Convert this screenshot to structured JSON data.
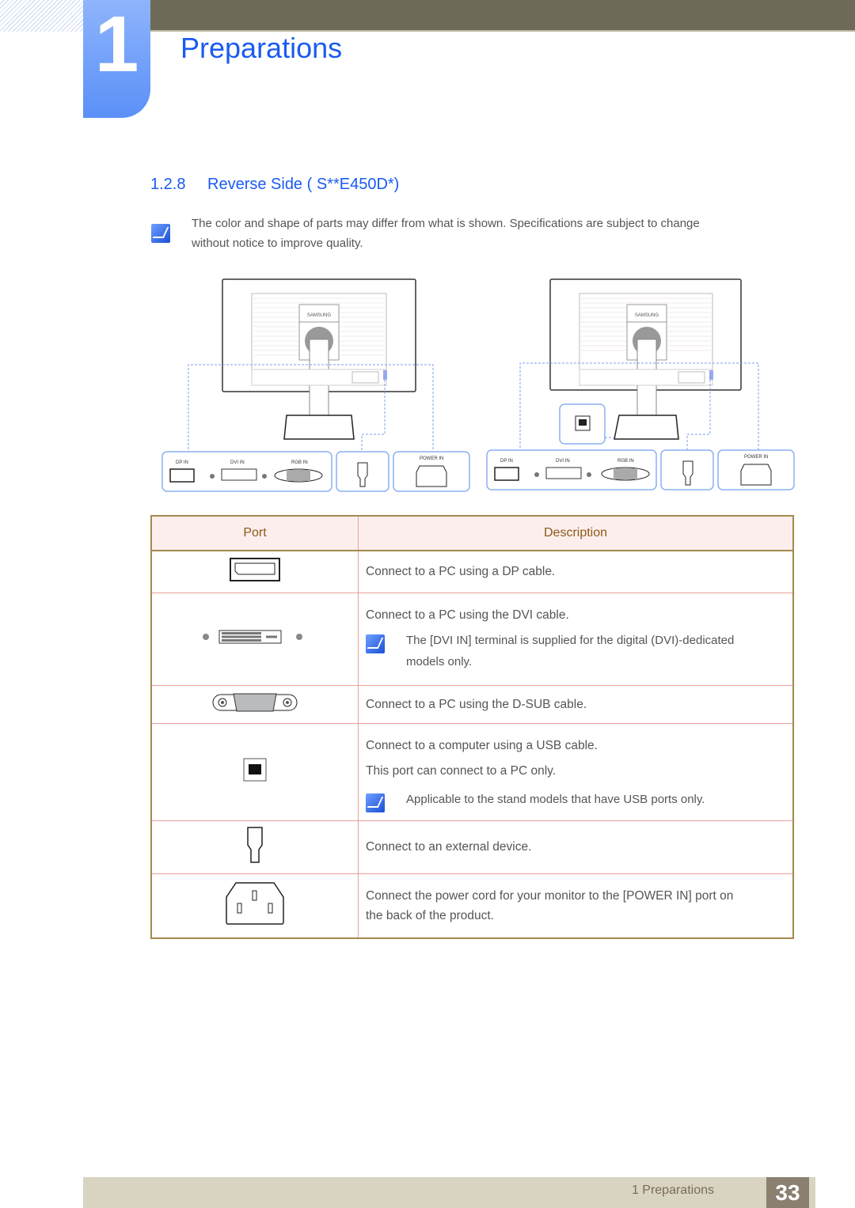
{
  "header": {
    "chapter_number": "1",
    "chapter_title": "Preparations"
  },
  "section": {
    "number": "1.2.8",
    "title": "Reverse Side ( S**E450D*)"
  },
  "intro_note": {
    "icon": "note-pencil-icon",
    "lines": [
      "The color and shape of parts may differ from what is shown. Specifications are subject to change",
      "without notice to improve quality."
    ]
  },
  "diagrams": {
    "left": {
      "brand": "SAMSUNG",
      "labels": {
        "dp": "DP IN",
        "dvi": "DVI IN",
        "rgb": "RGB IN",
        "power": "POWER IN"
      }
    },
    "right": {
      "brand": "SAMSUNG",
      "labels": {
        "dp": "DP IN",
        "dvi": "DVI IN",
        "rgb": "RGB IN",
        "power": "POWER IN"
      }
    }
  },
  "table": {
    "headers": {
      "port": "Port",
      "description": "Description"
    },
    "rows": [
      {
        "port_icon": "displayport-icon",
        "lines": [
          "Connect to a PC using a DP cable."
        ]
      },
      {
        "port_icon": "dvi-port-icon",
        "lines": [
          "Connect to a PC using the DVI cable."
        ],
        "note": [
          "The [DVI IN] terminal is supplied for the digital (DVI)-dedicated",
          "models only."
        ]
      },
      {
        "port_icon": "dsub-port-icon",
        "lines": [
          "Connect to a PC using the D-SUB cable."
        ]
      },
      {
        "port_icon": "usb-port-icon",
        "lines": [
          "Connect to a computer using a USB cable.",
          "This port can connect to a PC only."
        ],
        "note": [
          "Applicable to the stand models that have USB ports only."
        ]
      },
      {
        "port_icon": "external-device-port-icon",
        "lines": [
          "Connect to an external device."
        ]
      },
      {
        "port_icon": "power-in-port-icon",
        "lines": [
          "Connect the power cord for your monitor to the [POWER IN] port on",
          "the back of the product."
        ]
      }
    ]
  },
  "footer": {
    "section_label": "1 Preparations",
    "page_number": "33"
  }
}
